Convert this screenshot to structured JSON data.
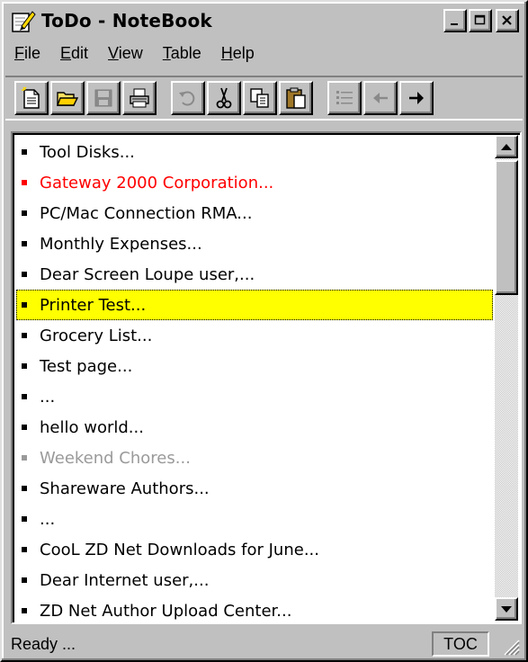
{
  "window": {
    "title": "ToDo - NoteBook",
    "minimize_glyph": "_",
    "maximize_glyph": "□",
    "close_glyph": "✕"
  },
  "menu": [
    {
      "accel": "F",
      "rest": "ile"
    },
    {
      "accel": "E",
      "rest": "dit"
    },
    {
      "accel": "V",
      "rest": "iew"
    },
    {
      "accel": "T",
      "rest": "able"
    },
    {
      "accel": "H",
      "rest": "elp"
    }
  ],
  "toolbar": {
    "new_glyph": "🗎",
    "open_glyph": "📂",
    "save_glyph": "💾",
    "print_glyph": "🖶",
    "undo_glyph": "↺",
    "cut_glyph": "✂",
    "copy_glyph": "⧉",
    "paste_glyph": "📋",
    "list_glyph": "☰",
    "back_glyph": "←",
    "forward_glyph": "→"
  },
  "list": {
    "items": [
      {
        "text": "Tool Disks...",
        "color": "#000000"
      },
      {
        "text": "Gateway 2000 Corporation...",
        "color": "#ff0000"
      },
      {
        "text": "PC/Mac Connection RMA...",
        "color": "#000000"
      },
      {
        "text": "Monthly Expenses...",
        "color": "#000000"
      },
      {
        "text": "Dear Screen Loupe user,...",
        "color": "#000000"
      },
      {
        "text": "Printer Test...",
        "color": "#000000",
        "selected": true
      },
      {
        "text": "Grocery List...",
        "color": "#000000"
      },
      {
        "text": "Test page...",
        "color": "#000000"
      },
      {
        "text": "...",
        "color": "#000000"
      },
      {
        "text": "hello world...",
        "color": "#000000"
      },
      {
        "text": "Weekend Chores...",
        "color": "#9a9a9a"
      },
      {
        "text": "Shareware Authors...",
        "color": "#000000"
      },
      {
        "text": "...",
        "color": "#000000"
      },
      {
        "text": "CooL ZD Net Downloads for June...",
        "color": "#000000"
      },
      {
        "text": "Dear Internet user,...",
        "color": "#000000"
      },
      {
        "text": "ZD Net Author Upload Center...",
        "color": "#000000"
      }
    ],
    "selection_color": "#ffff00"
  },
  "status": {
    "text": "Ready ...",
    "panel": "TOC"
  }
}
